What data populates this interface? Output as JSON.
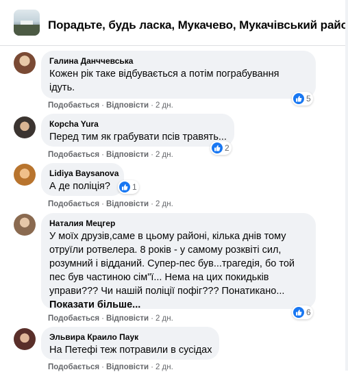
{
  "header": {
    "title": "Порадьте, будь ласка, Мукачево, Мукачівський район"
  },
  "actions": {
    "like_label": "Подобається",
    "reply_label": "Відповісти"
  },
  "comments": [
    {
      "author": "Галина Данччевська",
      "lines": [
        "Кожен рік таке відбувається а потім пограбування",
        "ідуть."
      ],
      "reactions": "5",
      "time": "2 дн."
    },
    {
      "author": "Корcha Yura",
      "lines": [
        "Перед тим як грабувати псів травять..."
      ],
      "reactions": "2",
      "time": "2 дн."
    },
    {
      "author": "Lidiya Baysanova",
      "lines": [
        "А де поліція?"
      ],
      "reactions": "1",
      "time": "2 дн."
    },
    {
      "author": "Наталия Мецгер",
      "lines": [
        "У моїх друзів,саме в цьому районі, кілька днів тому",
        "отруїли ротвелера. 8 років - у самому розквіті сил,",
        "розумний і відданий. Супер-пес був...трагедія, бо той",
        "пес був частиною сім\"ї... Нема на цих покидьків",
        "управи??? Чи нашій поліції пофіг??? Понатикано..."
      ],
      "see_more": "Показати більше...",
      "reactions": "6",
      "time": "2 дн."
    },
    {
      "author": "Эльвира Краило Паук",
      "lines": [
        "На Петефі теж потравили в сусідах"
      ],
      "time": "2 дн."
    }
  ]
}
